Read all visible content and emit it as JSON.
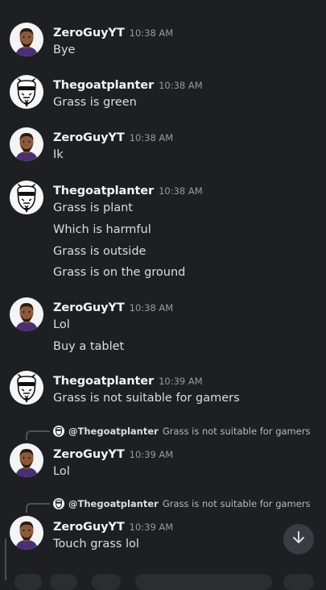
{
  "messages": [
    {
      "author": "ZeroGuyYT",
      "time": "10:38 AM",
      "avatar": "lebron-avatar",
      "lines": [
        "Bye"
      ]
    },
    {
      "author": "Thegoatplanter",
      "time": "10:38 AM",
      "avatar": "goat-avatar",
      "lines": [
        "Grass is green"
      ]
    },
    {
      "author": "ZeroGuyYT",
      "time": "10:38 AM",
      "avatar": "lebron-avatar",
      "lines": [
        "Ik"
      ]
    },
    {
      "author": "Thegoatplanter",
      "time": "10:38 AM",
      "avatar": "goat-avatar",
      "lines": [
        "Grass is plant",
        "Which is harmful",
        "Grass is outside",
        "Grass is on the ground"
      ]
    },
    {
      "author": "ZeroGuyYT",
      "time": "10:38 AM",
      "avatar": "lebron-avatar",
      "lines": [
        "Lol",
        "Buy a tablet"
      ]
    },
    {
      "author": "Thegoatplanter",
      "time": "10:39 AM",
      "avatar": "goat-avatar",
      "lines": [
        "Grass is not suitable for gamers"
      ]
    },
    {
      "author": "ZeroGuyYT",
      "time": "10:39 AM",
      "avatar": "lebron-avatar",
      "lines": [
        "Lol"
      ],
      "reply": {
        "author": "@Thegoatplanter",
        "text": "Grass is not suitable for gamers"
      }
    },
    {
      "author": "ZeroGuyYT",
      "time": "10:39 AM",
      "avatar": "lebron-avatar",
      "lines": [
        "Touch grass lol"
      ],
      "reply": {
        "author": "@Thegoatplanter",
        "text": "Grass is not suitable for gamers"
      }
    }
  ],
  "jump_button": {
    "icon": "arrow-down-icon"
  },
  "colors": {
    "background": "#1e1f22",
    "author": "#f2f3f5",
    "timestamp": "#949ba4",
    "text": "#dbdee1"
  }
}
